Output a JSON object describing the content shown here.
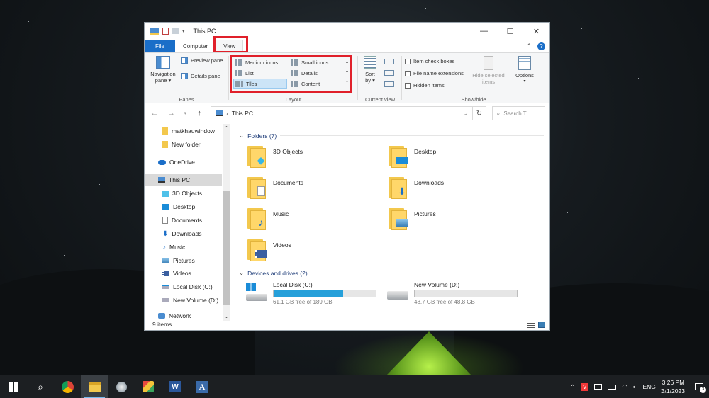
{
  "window": {
    "title": "This PC",
    "controls": {
      "minimize": "—",
      "maximize": "☐",
      "close": "✕"
    }
  },
  "tabs": {
    "file": "File",
    "computer": "Computer",
    "view": "View"
  },
  "ribbon": {
    "panes": {
      "navigation_pane": "Navigation pane ▾",
      "preview_pane": "Preview pane",
      "details_pane": "Details pane",
      "label": "Panes"
    },
    "layout": {
      "items": [
        {
          "label": "Medium icons"
        },
        {
          "label": "Small icons"
        },
        {
          "label": "List"
        },
        {
          "label": "Details"
        },
        {
          "label": "Tiles",
          "selected": true
        },
        {
          "label": "Content"
        }
      ],
      "label": "Layout"
    },
    "current_view": {
      "sort_by": "Sort by ▾",
      "label": "Current view"
    },
    "show_hide": {
      "item_check_boxes": "Item check boxes",
      "file_name_extensions": "File name extensions",
      "hidden_items": "Hidden items",
      "hide_selected_items": "Hide selected items",
      "options": "Options",
      "label": "Show/hide"
    }
  },
  "address": {
    "path": "This PC",
    "search_placeholder": "Search T..."
  },
  "nav": {
    "items": [
      {
        "label": "matkhauwindow",
        "icon": "folder-icon"
      },
      {
        "label": "New folder",
        "icon": "folder-icon"
      },
      {
        "label": "OneDrive",
        "icon": "cloud-icon"
      },
      {
        "label": "This PC",
        "icon": "computer-icon",
        "selected": true
      },
      {
        "label": "3D Objects",
        "icon": "cube-icon"
      },
      {
        "label": "Desktop",
        "icon": "desktop-icon"
      },
      {
        "label": "Documents",
        "icon": "document-icon"
      },
      {
        "label": "Downloads",
        "icon": "download-icon"
      },
      {
        "label": "Music",
        "icon": "music-icon"
      },
      {
        "label": "Pictures",
        "icon": "picture-icon"
      },
      {
        "label": "Videos",
        "icon": "video-icon"
      },
      {
        "label": "Local Disk (C:)",
        "icon": "drive-icon"
      },
      {
        "label": "New Volume (D:)",
        "icon": "drive-icon"
      },
      {
        "label": "Network",
        "icon": "network-icon"
      }
    ]
  },
  "content": {
    "folders_header": "Folders (7)",
    "folders": [
      {
        "label": "3D Objects",
        "badge": "cube"
      },
      {
        "label": "Desktop",
        "badge": "desktop"
      },
      {
        "label": "Documents",
        "badge": "doc"
      },
      {
        "label": "Downloads",
        "badge": "down"
      },
      {
        "label": "Music",
        "badge": "music"
      },
      {
        "label": "Pictures",
        "badge": "pic"
      },
      {
        "label": "Videos",
        "badge": "video"
      }
    ],
    "drives_header": "Devices and drives (2)",
    "drives": [
      {
        "label": "Local Disk (C:)",
        "free": "61.1 GB free of 189 GB",
        "used_fraction": 0.68
      },
      {
        "label": "New Volume (D:)",
        "free": "48.7 GB free of 48.8 GB",
        "used_fraction": 0.002
      }
    ]
  },
  "status": {
    "items_count": "9 items"
  },
  "taskbar": {
    "language": "ENG",
    "time": "3:26 PM",
    "date": "3/1/2023",
    "notifications": "3"
  },
  "colors": {
    "accent": "#1a6ec8",
    "highlight": "#e0202a",
    "bar_fill": "#26a0da"
  }
}
